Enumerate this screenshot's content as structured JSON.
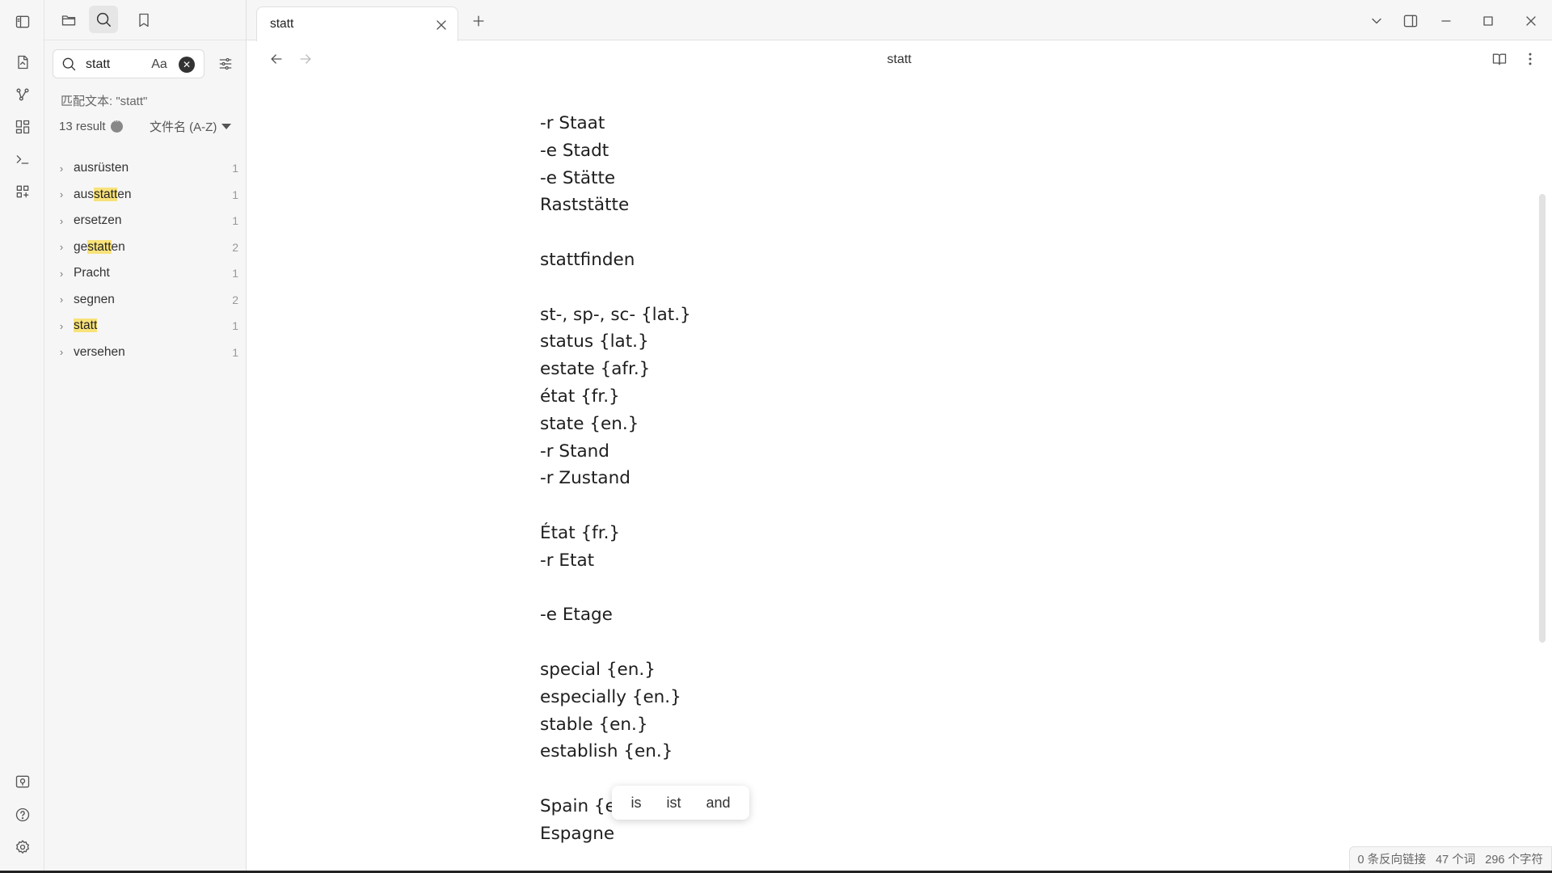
{
  "ribbon": {
    "icons": [
      "toggle-sidebar-icon",
      "open-note-icon",
      "graph-view-icon",
      "canvas-icon",
      "command-palette-icon",
      "templates-icon",
      "vault-icon",
      "help-icon",
      "settings-icon"
    ]
  },
  "sidebar": {
    "search": {
      "value": "statt",
      "placeholder": "",
      "match_case_label": "Aa"
    },
    "match_text": "匹配文本: \"statt\"",
    "result_count": "13 result",
    "sort_label": "文件名 (A-Z)",
    "results": [
      {
        "pre": "ausrüsten",
        "hl": "",
        "post": "",
        "count": "1"
      },
      {
        "pre": "aus",
        "hl": "statt",
        "post": "en",
        "count": "1"
      },
      {
        "pre": "ersetzen",
        "hl": "",
        "post": "",
        "count": "1"
      },
      {
        "pre": "ge",
        "hl": "statt",
        "post": "en",
        "count": "2"
      },
      {
        "pre": "Pracht",
        "hl": "",
        "post": "",
        "count": "1"
      },
      {
        "pre": "segnen",
        "hl": "",
        "post": "",
        "count": "2"
      },
      {
        "pre": "",
        "hl": "statt",
        "post": "",
        "count": "1"
      },
      {
        "pre": "versehen",
        "hl": "",
        "post": "",
        "count": "1"
      }
    ]
  },
  "tab": {
    "title": "statt"
  },
  "document": {
    "title": "statt",
    "lines": [
      "-r Staat",
      "-e Stadt",
      "-e Stätte",
      "Raststätte",
      "",
      "stattfinden",
      "",
      "st-, sp-, sc- {lat.}",
      "status {lat.}",
      "estate {afr.}",
      "état {fr.}",
      "state {en.}",
      "-r Stand",
      "-r Zustand",
      "",
      "État {fr.}",
      "-r Etat",
      "",
      "-e Etage",
      "",
      "special {en.}",
      "especially {en.}",
      "stable {en.}",
      "establish {en.}",
      "",
      "Spain {en.}",
      "Espagne"
    ]
  },
  "suggestion_popup": {
    "items": [
      "is",
      "ist",
      "and"
    ]
  },
  "status": {
    "backlinks": "0 条反向链接",
    "words": "47 个词",
    "chars": "296 个字符"
  },
  "colors": {
    "highlight": "#f8e27a",
    "sidebar_bg": "#f6f6f6",
    "text": "#1e1e1e"
  }
}
